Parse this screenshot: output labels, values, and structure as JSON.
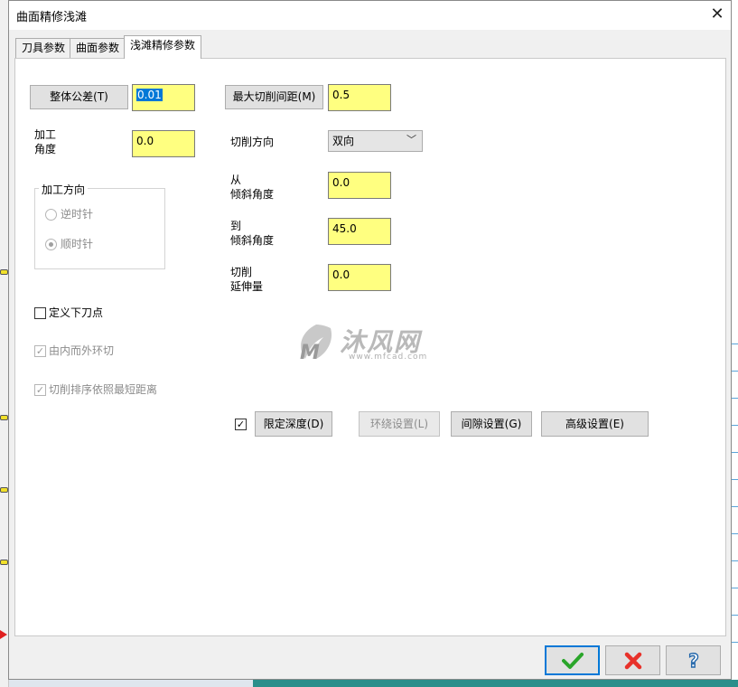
{
  "dialog": {
    "title": "曲面精修浅滩"
  },
  "tabs": [
    {
      "label": "刀具参数"
    },
    {
      "label": "曲面参数"
    },
    {
      "label": "浅滩精修参数"
    }
  ],
  "left": {
    "tolerance_button": "整体公差(T)",
    "tolerance_value": "0.01",
    "angle_label_line1": "加工",
    "angle_label_line2": "角度",
    "angle_value": "0.0",
    "direction_group_title": "加工方向",
    "ccw_label": "逆时针",
    "cw_label": "顺时针",
    "entry_point_label": "定义下刀点",
    "inside_out_label": "由内而外环切",
    "shortest_label": "切削排序依照最短距离"
  },
  "right": {
    "stepover_button": "最大切削间距(M)",
    "stepover_value": "0.5",
    "cut_direction_label": "切削方向",
    "cut_direction_value": "双向",
    "from_label_line1": "从",
    "from_label_line2": "倾斜角度",
    "from_value": "0.0",
    "to_label_line1": "到",
    "to_label_line2": "倾斜角度",
    "to_value": "45.0",
    "extension_label_line1": "切削",
    "extension_label_line2": "延伸量",
    "extension_value": "0.0"
  },
  "bottom_buttons": {
    "limit_depth": "限定深度(D)",
    "loop_settings": "环绕设置(L)",
    "gap_settings": "间隙设置(G)",
    "advanced_settings": "高级设置(E)"
  },
  "watermark": {
    "text": "沐风网",
    "url": "www.mfcad.com"
  },
  "colors": {
    "input_yellow": "#ffff80",
    "selection_blue": "#0078d7",
    "ok_green": "#2aa52a",
    "cancel_red": "#e8312a",
    "help_blue": "#2266aa"
  },
  "icons": {
    "ok": "checkmark-icon",
    "cancel": "cross-icon",
    "help": "question-icon",
    "close": "close-icon"
  }
}
